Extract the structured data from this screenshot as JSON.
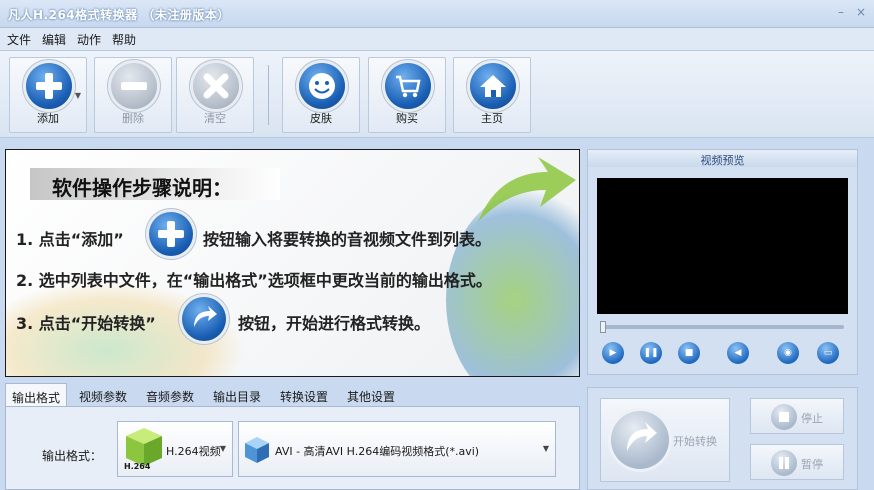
{
  "window": {
    "title": "凡人H.264格式转换器 （未注册版本）",
    "minimize_glyph": "–",
    "close_glyph": "×"
  },
  "menu": [
    "文件",
    "编辑",
    "动作",
    "帮助"
  ],
  "toolbar": {
    "add": "添加",
    "delete": "删除",
    "clear": "清空",
    "skin": "皮肤",
    "buy": "购买",
    "home": "主页"
  },
  "guide": {
    "heading": "软件操作步骤说明：",
    "step1_a": "1. 点击“添加”",
    "step1_b": "按钮输入将要转换的音视频文件到列表。",
    "step2": "2. 选中列表中文件，在“输出格式”选项框中更改当前的输出格式。",
    "step3_a": "3. 点击“开始转换”",
    "step3_b": "按钮，开始进行格式转换。"
  },
  "preview": {
    "title": "视频预览",
    "seek_position": 0.0
  },
  "tabs": [
    "输出格式",
    "视频参数",
    "音频参数",
    "输出目录",
    "转换设置",
    "其他设置"
  ],
  "output": {
    "label": "输出格式：",
    "category_icon_text": "H.264",
    "category_value": "H.264视频",
    "format_value": "AVI - 高清AVI H.264编码视频格式(*.avi)"
  },
  "actions": {
    "start": "开始转换",
    "stop": "停止",
    "pause": "暂停"
  },
  "colors": {
    "accent_blue": "#1a5fb4",
    "disabled_gray": "#b6bfcb",
    "window_bg": "#c9d9ef"
  },
  "icons": {
    "add": "plus-icon",
    "delete": "minus-icon",
    "clear": "x-icon",
    "skin": "smiley-icon",
    "buy": "cart-icon",
    "home": "house-icon"
  }
}
